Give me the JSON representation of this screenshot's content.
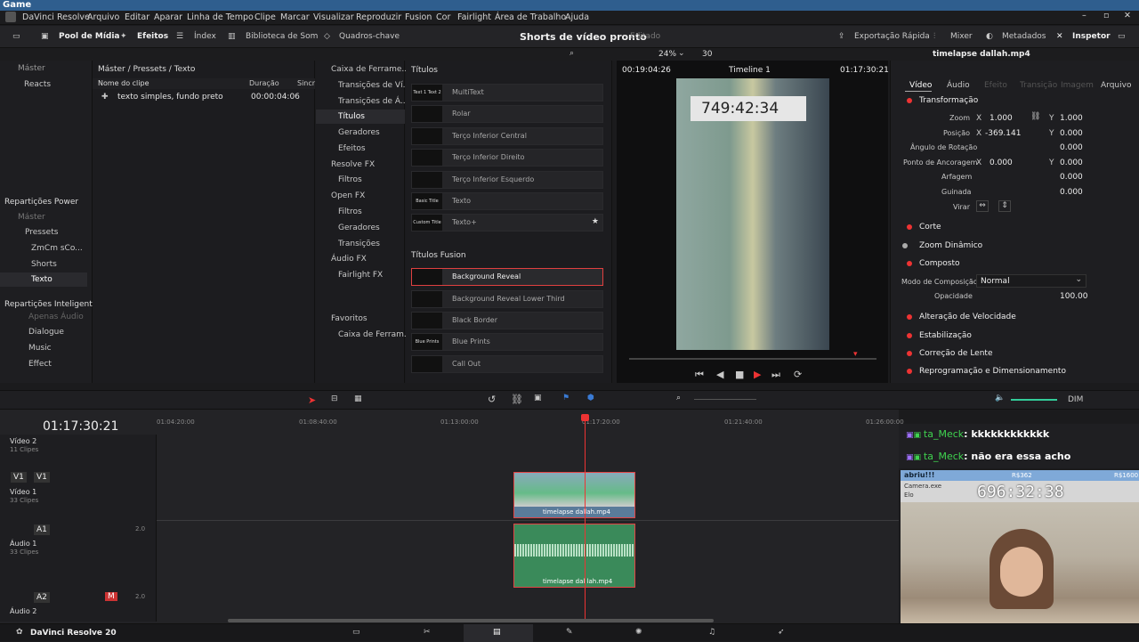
{
  "title": "Game",
  "menu": [
    "DaVinci Resolve",
    "Arquivo",
    "Editar",
    "Aparar",
    "Linha de Tempo",
    "Clipe",
    "Marcar",
    "Visualizar",
    "Reproduzir",
    "Fusion",
    "Cor",
    "Fairlight",
    "Área de Trabalho",
    "Ajuda"
  ],
  "toolbar": {
    "media_pool": "Pool de Mídia",
    "effects": "Efeitos",
    "index": "Índex",
    "sound_library": "Biblioteca de Som",
    "keyframes": "Quadros-chave",
    "project": "Shorts de vídeo pronto",
    "edited": "Editado",
    "quick_export": "Exportação Rápida",
    "mixer": "Mixer",
    "metadata": "Metadados",
    "inspector": "Inspetor"
  },
  "subbar": {
    "zoom": "24%",
    "fps": "30",
    "clip_name": "timelapse dallah.mp4"
  },
  "mediapool": {
    "bins": [
      "Máster",
      "Reacts"
    ],
    "power_bins_title": "Repartições Power",
    "power_bins": [
      "Máster",
      "Pressets",
      "ZmCm sCo...",
      "Shorts",
      "Texto"
    ],
    "smart_bins_title": "Repartições Inteligentes",
    "smart_bins": [
      "Apenas Áudio",
      "Dialogue",
      "Music",
      "Effect"
    ]
  },
  "cliplist": {
    "path": "Máster / Pressets / Texto",
    "col_name": "Nome do clipe",
    "col_duration": "Duração",
    "col_sync": "Sincr",
    "clip_name": "texto simples, fundo preto",
    "clip_duration": "00:00:04:06"
  },
  "fxtree": [
    "Caixa de Ferrame...",
    "Transições de Ví...",
    "Transições de Á...",
    "Títulos",
    "Geradores",
    "Efeitos",
    "Resolve FX",
    "Filtros",
    "Open FX",
    "Filtros",
    "Geradores",
    "Transições",
    "Áudio FX",
    "Fairlight FX",
    "Favoritos",
    "Caixa de Ferram..."
  ],
  "fxlist": {
    "titles_header": "Títulos",
    "titles": [
      "MultiText",
      "Rolar",
      "Terço Inferior Central",
      "Terço Inferior Direito",
      "Terço Inferior Esquerdo",
      "Texto",
      "Texto+"
    ],
    "thumbs": [
      "Text 1 Text 2",
      "",
      "",
      "",
      "",
      "Basic Title",
      "Custom Title"
    ],
    "fusion_header": "Títulos Fusion",
    "fusion": [
      "Background Reveal",
      "Background Reveal Lower Third",
      "Black Border",
      "Blue Prints",
      "Call Out"
    ],
    "fusion_thumbs": [
      "",
      "",
      "",
      "Blue Prints",
      ""
    ]
  },
  "viewer": {
    "tc_left": "00:19:04:26",
    "timeline_name": "Timeline 1",
    "tc_right": "01:17:30:21",
    "overlay_time": "749:42:34"
  },
  "inspector": {
    "tabs": [
      "Vídeo",
      "Áudio",
      "Efeito",
      "Transição",
      "Imagem",
      "Arquivo"
    ],
    "transform": "Transformação",
    "zoom_label": "Zoom",
    "zoom_x": "1.000",
    "zoom_y": "1.000",
    "pos_label": "Posição",
    "pos_x": "-369.141",
    "pos_y": "0.000",
    "rot_label": "Ângulo de Rotação",
    "rot": "0.000",
    "anchor_label": "Ponto de Ancoragem",
    "anchor_x": "0.000",
    "anchor_y": "0.000",
    "pitch_label": "Arfagem",
    "pitch": "0.000",
    "yaw_label": "Guinada",
    "yaw": "0.000",
    "flip_label": "Virar",
    "crop": "Corte",
    "dyn_zoom": "Zoom Dinâmico",
    "composite": "Composto",
    "comp_mode_label": "Modo de Composição",
    "comp_mode": "Normal",
    "opacity_label": "Opacidade",
    "opacity": "100.00",
    "speed": "Alteração de Velocidade",
    "stabilization": "Estabilização",
    "lens": "Correção de Lente",
    "reframe": "Reprogramação e Dimensionamento",
    "x": "X",
    "y": "Y"
  },
  "timeline": {
    "timecode": "01:17:30:21",
    "dim": "DIM",
    "ruler": [
      "01:04:20:00",
      "01:08:40:00",
      "01:13:00:00",
      "01:17:20:00",
      "01:21:40:00",
      "01:26:00:00"
    ],
    "tracks": [
      {
        "name": "Vídeo 2",
        "clips": "11 Clipes"
      },
      {
        "name": "Vídeo 1",
        "clips": "33 Clipes",
        "tag": "V1"
      },
      {
        "name": "Áudio 1",
        "clips": "33 Clipes",
        "tag": "A1",
        "level": "2.0"
      },
      {
        "name": "Áudio 2",
        "tag": "A2",
        "level": "2.0"
      }
    ],
    "clip_label": "timelapse dallah.mp4",
    "clip_label_audio": "timelapse dal lah.mp4"
  },
  "chat": [
    {
      "user": "ta_Meck",
      "msg": ": kkkkkkkkkkkk"
    },
    {
      "user": "ta_Meck",
      "msg": ": não era essa acho"
    }
  ],
  "overlay": {
    "banner": "abriu!!!",
    "cost1": "R$362",
    "cost2": "R$1600",
    "cam_name": "Camera.exe",
    "cam_sub": "Elo",
    "cam_timer": "696:32:38"
  },
  "app_name": "DaVinci Resolve 20",
  "colors": {
    "accent_red": "#e33",
    "title_blue": "#2f5e8e",
    "chat_user": "#3fd24f",
    "audio_green": "#3a8a5a"
  }
}
